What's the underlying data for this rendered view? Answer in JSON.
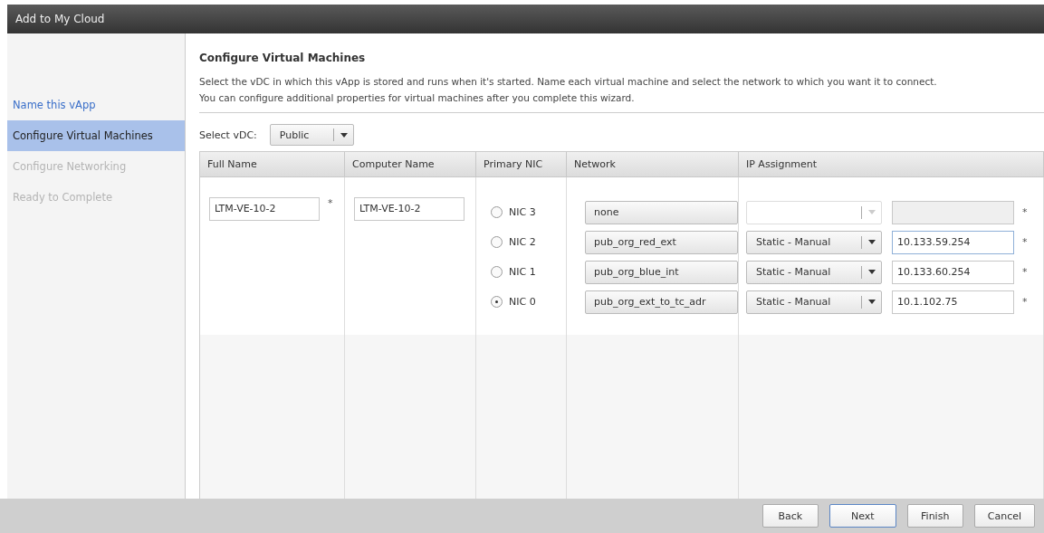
{
  "window": {
    "title": "Add to My Cloud"
  },
  "steps": [
    {
      "label": "Name this vApp",
      "selected": false,
      "disabled": false
    },
    {
      "label": "Configure Virtual Machines",
      "selected": true,
      "disabled": false
    },
    {
      "label": "Configure Networking",
      "selected": false,
      "disabled": true
    },
    {
      "label": "Ready to Complete",
      "selected": false,
      "disabled": true
    }
  ],
  "heading": "Configure Virtual Machines",
  "description": "Select the vDC in which this vApp is stored and runs when it's started. Name each virtual machine and select the network to which you want it to connect. You can configure additional properties for virtual machines after you complete this wizard.",
  "vdc": {
    "label": "Select vDC:",
    "value": "Public"
  },
  "table": {
    "columns": [
      "Full Name",
      "Computer Name",
      "Primary NIC",
      "Network",
      "IP Assignment"
    ],
    "vm": {
      "full_name": "LTM-VE-10-2",
      "full_name_mark": "*",
      "computer_name": "LTM-VE-10-2"
    },
    "nics": [
      {
        "label": "NIC 3",
        "selected": false,
        "network": "none",
        "disabled": true,
        "focused": false,
        "required_mark": "*"
      },
      {
        "label": "NIC 2",
        "selected": false,
        "network": "pub_org_red_ext",
        "disabled": false,
        "ip_mode": "Static - Manual",
        "ip_address": "10.133.59.254",
        "focused": true,
        "required_mark": "*"
      },
      {
        "label": "NIC 1",
        "selected": false,
        "network": "pub_org_blue_int",
        "disabled": false,
        "ip_mode": "Static - Manual",
        "ip_address": "10.133.60.254",
        "focused": false,
        "required_mark": "*"
      },
      {
        "label": "NIC 0",
        "selected": true,
        "network": "pub_org_ext_to_tc_adr",
        "disabled": false,
        "ip_mode": "Static - Manual",
        "ip_address": "10.1.102.75",
        "focused": false,
        "required_mark": "*"
      }
    ]
  },
  "buttons": [
    {
      "label": "Back",
      "default": false
    },
    {
      "label": "Next",
      "default": true
    },
    {
      "label": "Finish",
      "default": false
    },
    {
      "label": "Cancel",
      "default": false
    }
  ]
}
